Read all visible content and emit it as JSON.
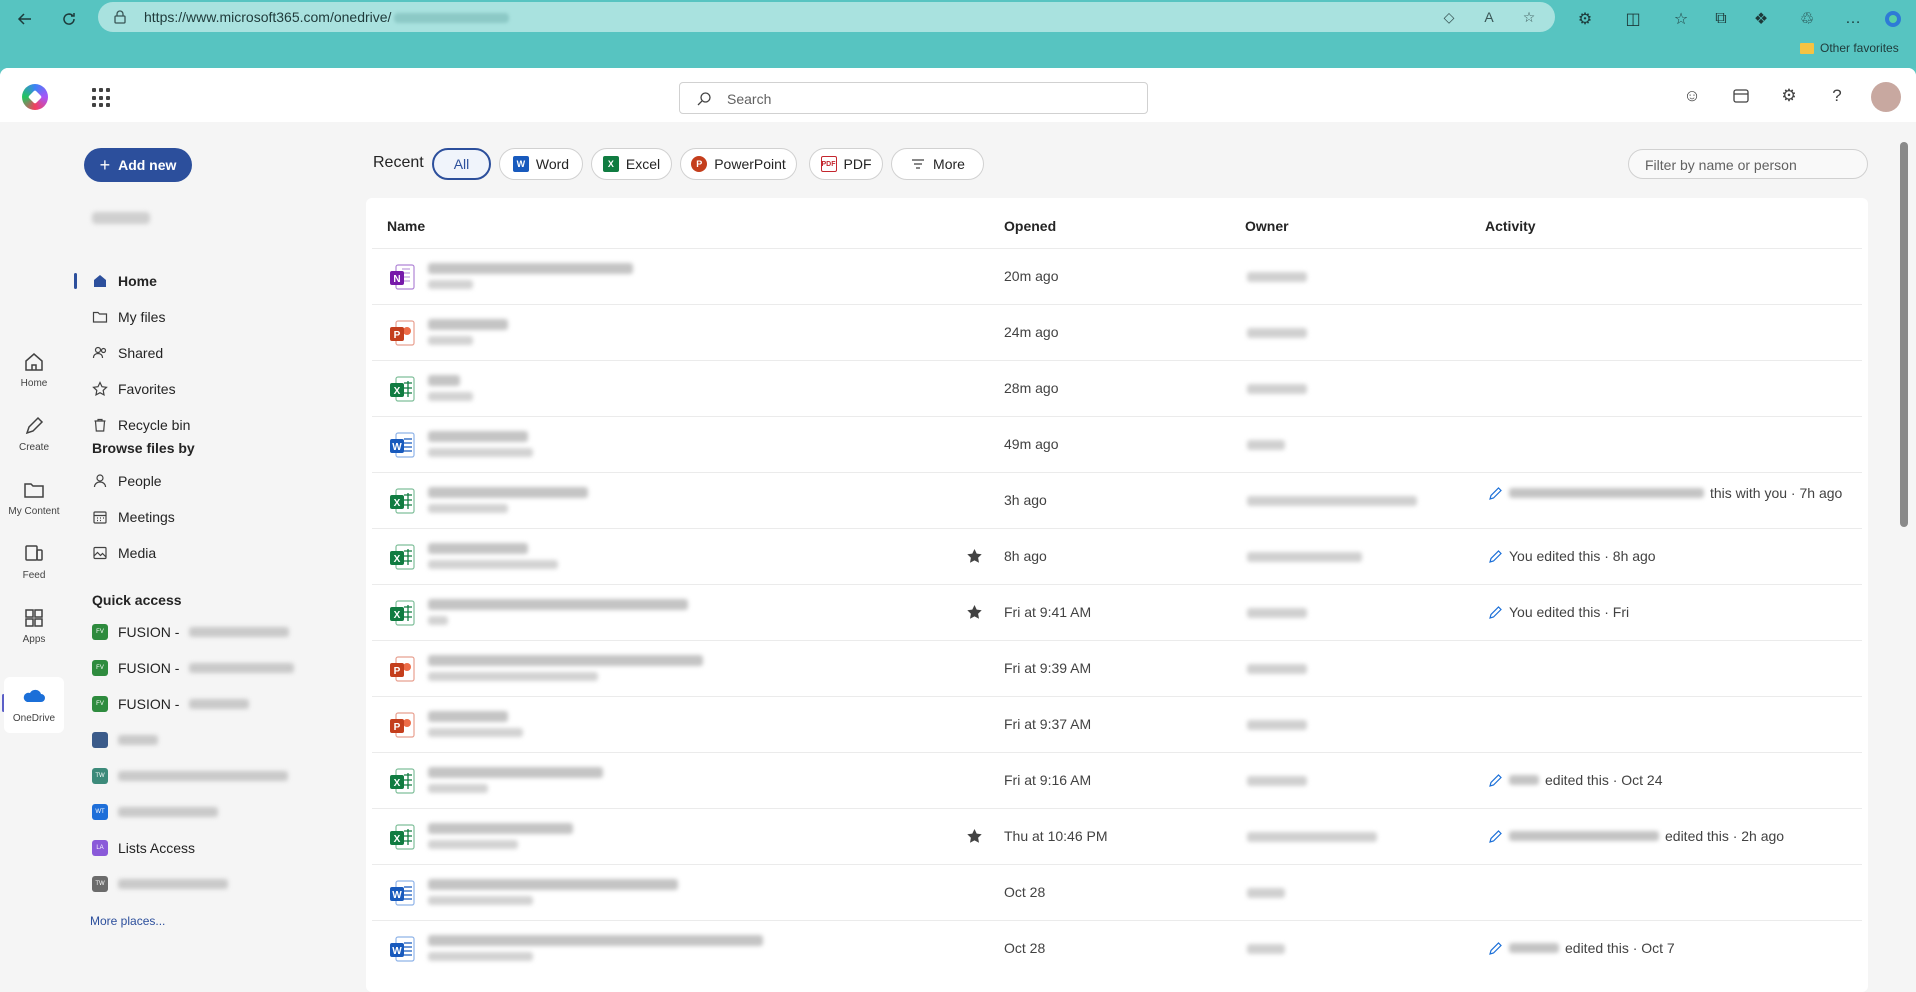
{
  "browser": {
    "url": "https://www.microsoft365.com/onedrive/",
    "favorites_label": "Other favorites"
  },
  "header": {
    "search_placeholder": "Search"
  },
  "rail": {
    "items": [
      {
        "label": "Home",
        "icon": "home-icon"
      },
      {
        "label": "Create",
        "icon": "pencil-icon"
      },
      {
        "label": "My Content",
        "icon": "folder-icon"
      },
      {
        "label": "Feed",
        "icon": "feed-icon"
      },
      {
        "label": "Apps",
        "icon": "apps-icon"
      },
      {
        "label": "OneDrive",
        "icon": "onedrive-icon"
      }
    ]
  },
  "nav": {
    "add_new": "Add new",
    "items": [
      {
        "label": "Home",
        "icon": "home-icon"
      },
      {
        "label": "My files",
        "icon": "folder-icon"
      },
      {
        "label": "Shared",
        "icon": "people-icon"
      },
      {
        "label": "Favorites",
        "icon": "star-icon"
      },
      {
        "label": "Recycle bin",
        "icon": "trash-icon"
      }
    ],
    "browse_heading": "Browse files by",
    "browse": [
      {
        "label": "People",
        "icon": "person-icon"
      },
      {
        "label": "Meetings",
        "icon": "calendar-icon"
      },
      {
        "label": "Media",
        "icon": "image-icon"
      }
    ],
    "quick_access_heading": "Quick access",
    "quick_access": [
      {
        "label": "FUSION -",
        "badge": "FV",
        "color": "#2e8b3e"
      },
      {
        "label": "FUSION -",
        "badge": "FV",
        "color": "#2e8b3e"
      },
      {
        "label": "FUSION -",
        "badge": "FV",
        "color": "#2e8b3e"
      },
      {
        "label": "",
        "badge": "",
        "color": "#3b5b8a"
      },
      {
        "label": "",
        "badge": "TW",
        "color": "#3c8a7a"
      },
      {
        "label": "",
        "badge": "WT",
        "color": "#1e6fd9"
      },
      {
        "label": "Lists Access",
        "badge": "LA",
        "color": "#8a5ad9"
      },
      {
        "label": "",
        "badge": "TW",
        "color": "#6b6b6b"
      }
    ],
    "more_places": "More places..."
  },
  "main": {
    "recent_label": "Recent",
    "filters": [
      "All",
      "Word",
      "Excel",
      "PowerPoint",
      "PDF",
      "More"
    ],
    "filter_placeholder": "Filter by name or person",
    "columns": [
      "Name",
      "Opened",
      "Owner",
      "Activity"
    ],
    "rows": [
      {
        "type": "onenote",
        "opened": "20m ago",
        "starred": false,
        "activity_prefix": "",
        "activity": ""
      },
      {
        "type": "powerpoint",
        "opened": "24m ago",
        "starred": false,
        "activity_prefix": "",
        "activity": ""
      },
      {
        "type": "excel",
        "opened": "28m ago",
        "starred": false,
        "activity_prefix": "",
        "activity": ""
      },
      {
        "type": "word",
        "opened": "49m ago",
        "starred": false,
        "activity_prefix": "",
        "activity": ""
      },
      {
        "type": "excel",
        "opened": "3h ago",
        "starred": false,
        "activity_prefix": "blur",
        "activity": "this with you · 7h ago"
      },
      {
        "type": "excel",
        "opened": "8h ago",
        "starred": true,
        "activity_prefix": "",
        "activity": "You edited this · 8h ago"
      },
      {
        "type": "excel",
        "opened": "Fri at 9:41 AM",
        "starred": true,
        "activity_prefix": "",
        "activity": "You edited this · Fri"
      },
      {
        "type": "powerpoint",
        "opened": "Fri at 9:39 AM",
        "starred": false,
        "activity_prefix": "",
        "activity": ""
      },
      {
        "type": "powerpoint",
        "opened": "Fri at 9:37 AM",
        "starred": false,
        "activity_prefix": "",
        "activity": ""
      },
      {
        "type": "excel",
        "opened": "Fri at 9:16 AM",
        "starred": false,
        "activity_prefix": "blur",
        "activity": "edited this · Oct 24"
      },
      {
        "type": "excel",
        "opened": "Thu at 10:46 PM",
        "starred": true,
        "activity_prefix": "blur",
        "activity": "edited this · 2h ago"
      },
      {
        "type": "word",
        "opened": "Oct 28",
        "starred": false,
        "activity_prefix": "",
        "activity": ""
      },
      {
        "type": "word",
        "opened": "Oct 28",
        "starred": false,
        "activity_prefix": "blur",
        "activity": "edited this · Oct 7"
      }
    ]
  }
}
